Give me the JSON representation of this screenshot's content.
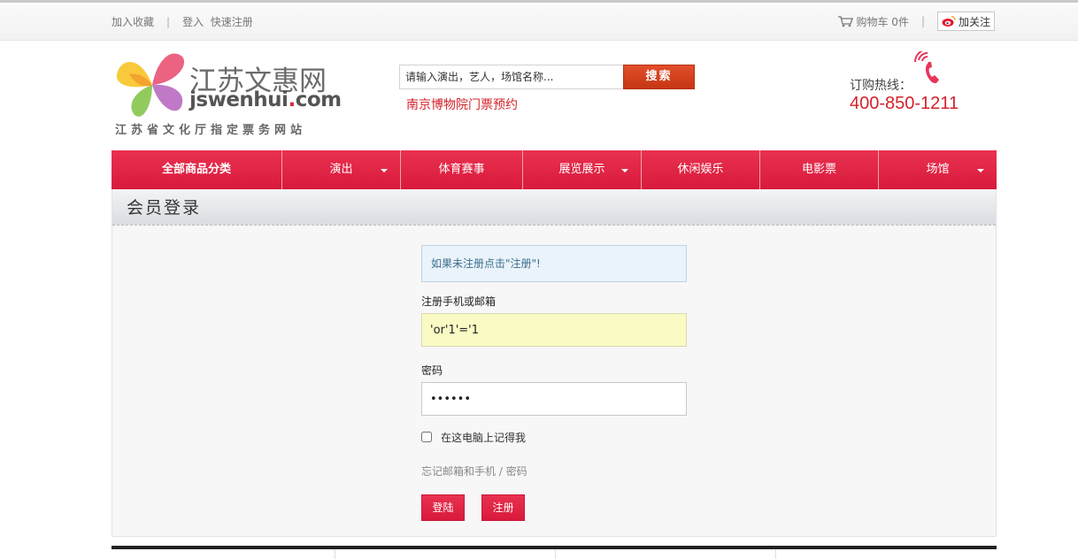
{
  "topbar": {
    "bookmark": "加入收藏",
    "login": "登入",
    "register": "快速注册",
    "cart": "购物车 0件",
    "follow": "加关注"
  },
  "logo": {
    "cn": "江苏文惠网",
    "en_prefix": "jswenhui",
    "en_dot": ".",
    "en_suffix": "com",
    "tagline": "江苏省文化厅指定票务网站"
  },
  "search": {
    "placeholder": "请输入演出，艺人，场馆名称...",
    "button": "搜索",
    "hot_link": "南京博物院门票预约"
  },
  "hotline": {
    "label": "订购热线：",
    "number": "400-850-1211"
  },
  "nav": {
    "items": [
      {
        "label": "全部商品分类"
      },
      {
        "label": "演出"
      },
      {
        "label": "体育赛事"
      },
      {
        "label": "展览展示"
      },
      {
        "label": "休闲娱乐"
      },
      {
        "label": "电影票"
      },
      {
        "label": "场馆"
      }
    ]
  },
  "login": {
    "title": "会员登录",
    "notice": "如果未注册点击\"注册\"!",
    "user_label": "注册手机或邮箱",
    "user_value": "'or'1'='1",
    "password_label": "密码",
    "password_value": "••••••",
    "remember": "在这电脑上记得我",
    "forgot": "忘记邮箱和手机 / 密码",
    "login_button": "登陆",
    "register_button": "注册"
  },
  "colors": {
    "brand_red": "#d81a3c",
    "search_orange": "#d1401c",
    "link_red": "#d4222a"
  }
}
